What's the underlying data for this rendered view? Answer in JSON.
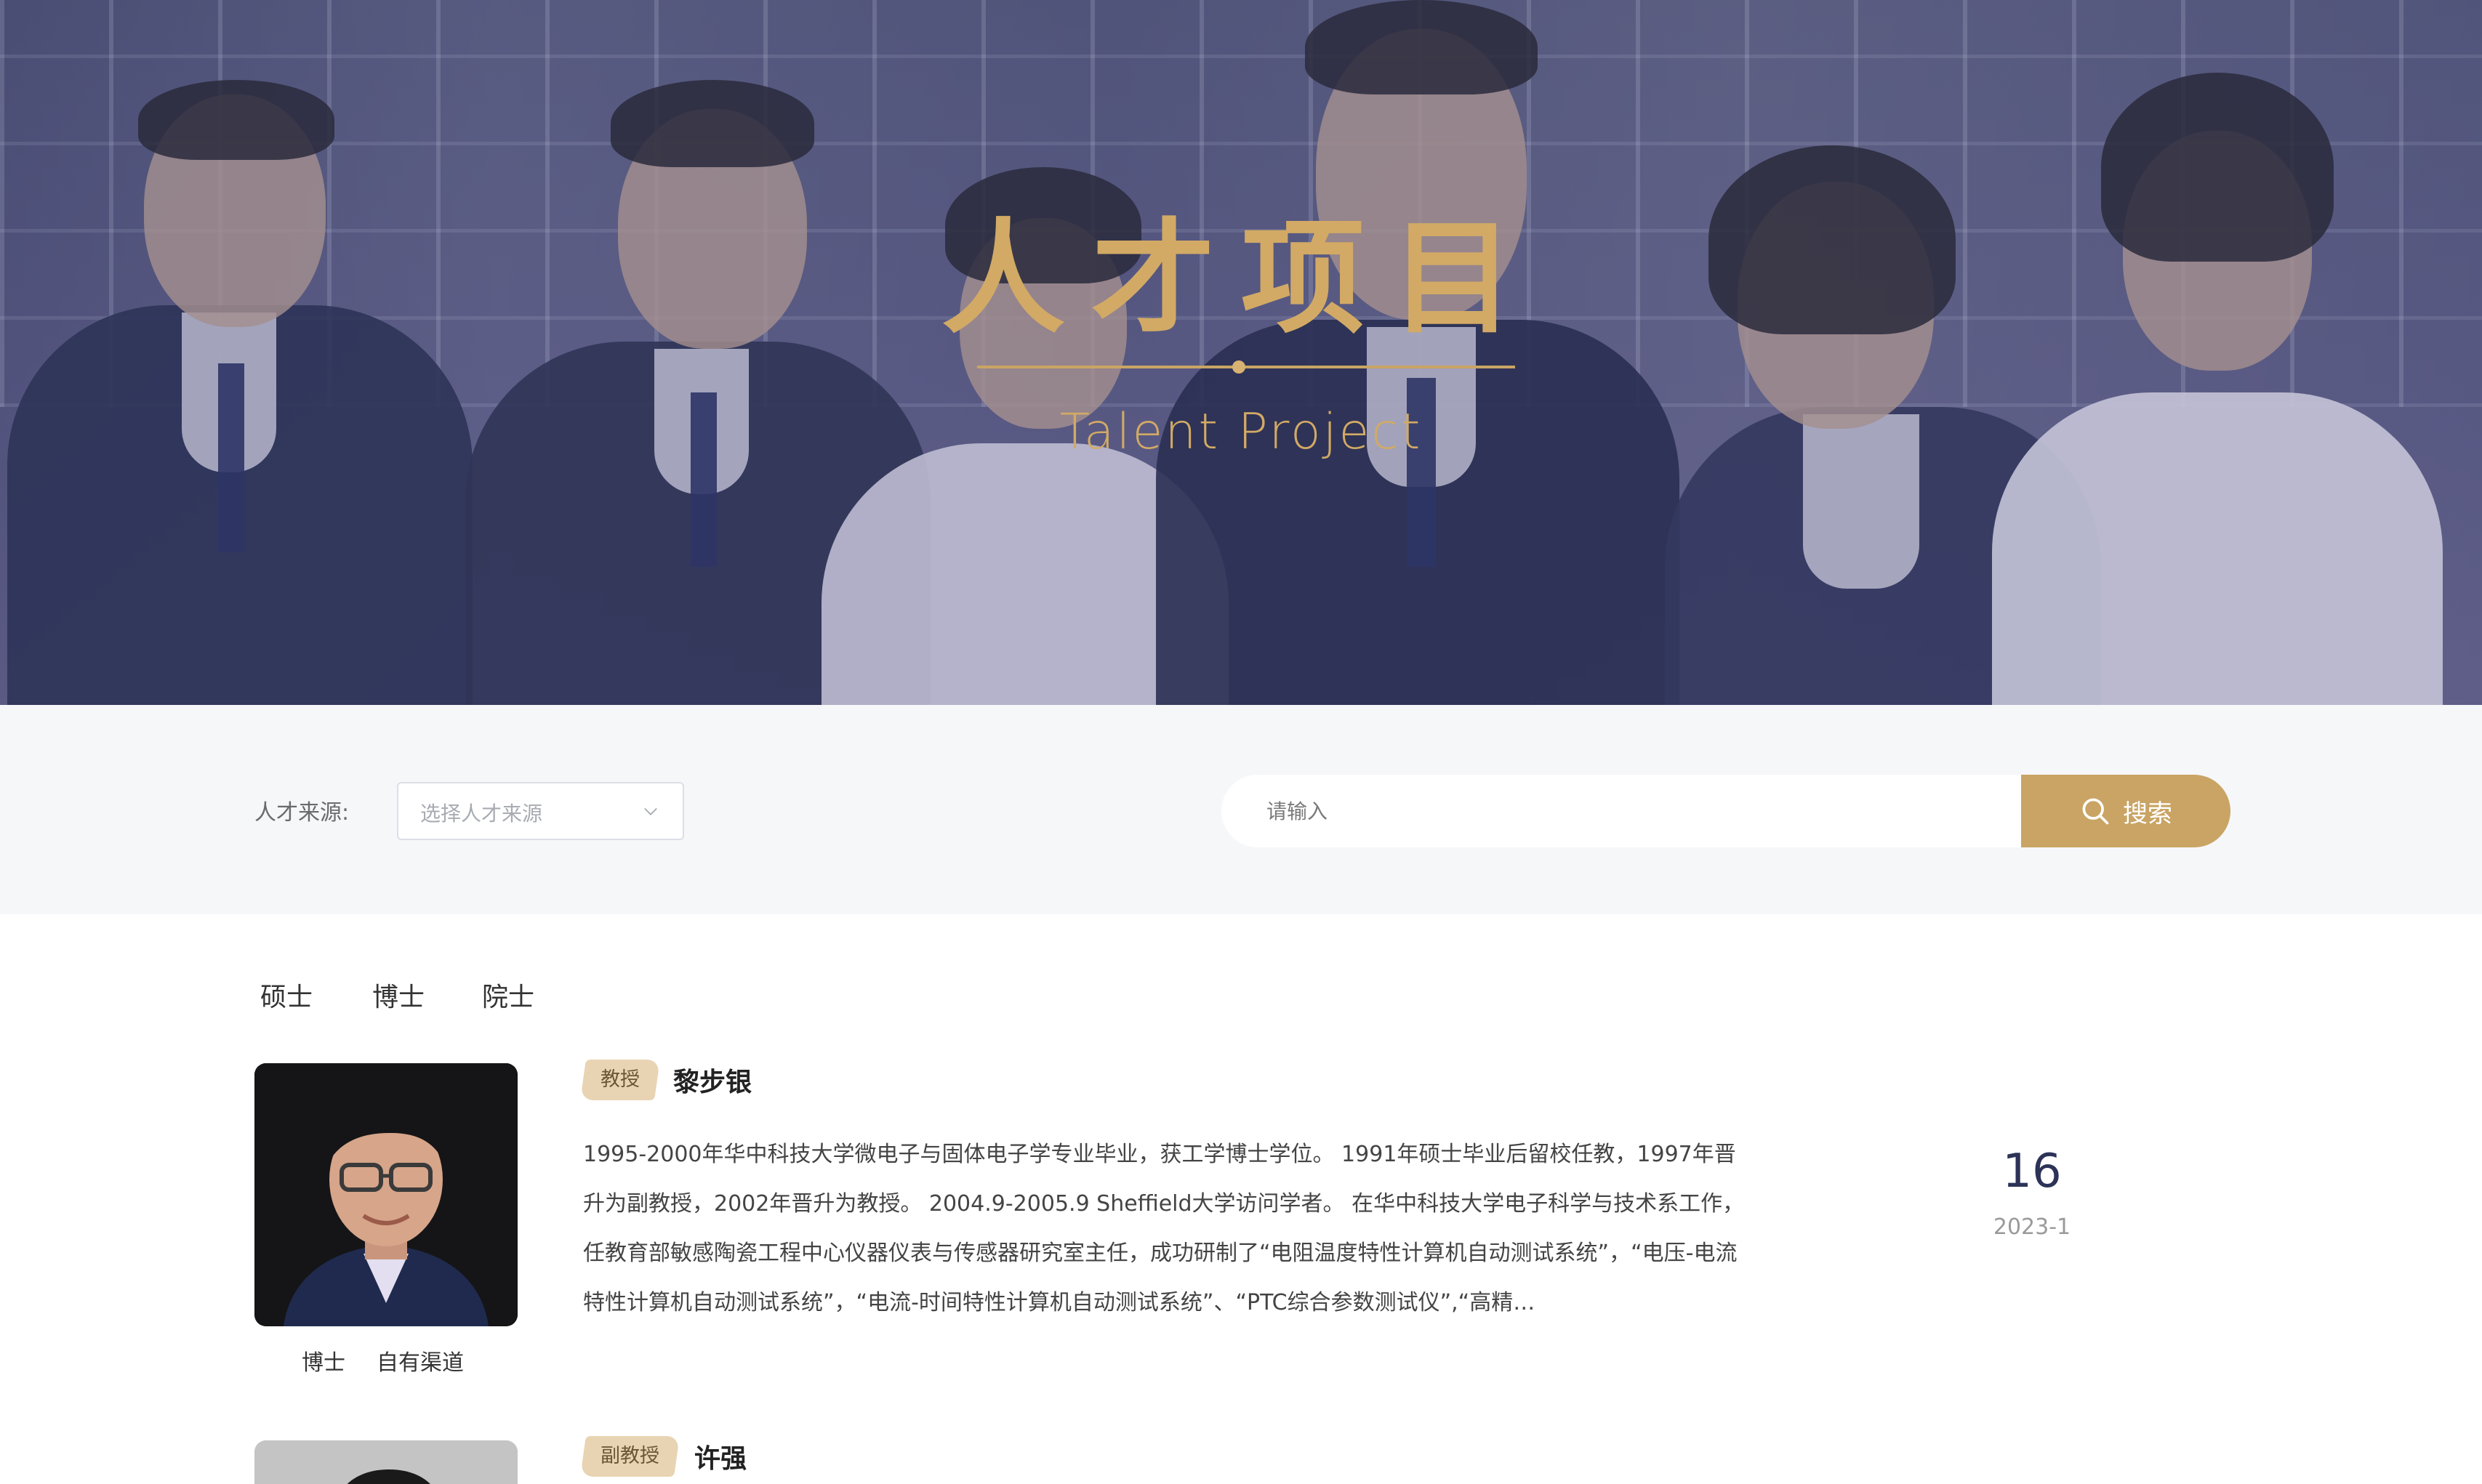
{
  "hero": {
    "title": "人才项目",
    "subtitle": "Talent Project"
  },
  "filter": {
    "source_label": "人才来源:",
    "source_placeholder": "选择人才来源",
    "search_placeholder": "请输入",
    "search_button": "搜索"
  },
  "tabs": [
    "硕士",
    "博士",
    "院士"
  ],
  "talents": [
    {
      "title_badge": "教授",
      "name": "黎步银",
      "degree": "博士",
      "channel": "自有渠道",
      "description": "1995-2000年华中科技大学微电子与固体电子学专业毕业，获工学博士学位。 1991年硕士毕业后留校任教，1997年晋升为副教授，2002年晋升为教授。 2004.9-2005.9 Sheffield大学访问学者。 在华中科技大学电子科学与技术系工作，任教育部敏感陶瓷工程中心仪器仪表与传感器研究室主任，成功研制了“电阻温度特性计算机自动测试系统”，“电压-电流特性计算机自动测试系统”，“电流-时间特性计算机自动测试系统”、“PTC综合参数测试仪”,“高精…",
      "day": "16",
      "month": "2023-1"
    },
    {
      "title_badge": "副教授",
      "name": "许强"
    }
  ],
  "colors": {
    "accent": "#c9a464",
    "hero_overlay": "#545484",
    "date_day": "#2c3357"
  },
  "icons": {
    "select_arrow": "chevron-down-icon",
    "search": "search-icon"
  }
}
